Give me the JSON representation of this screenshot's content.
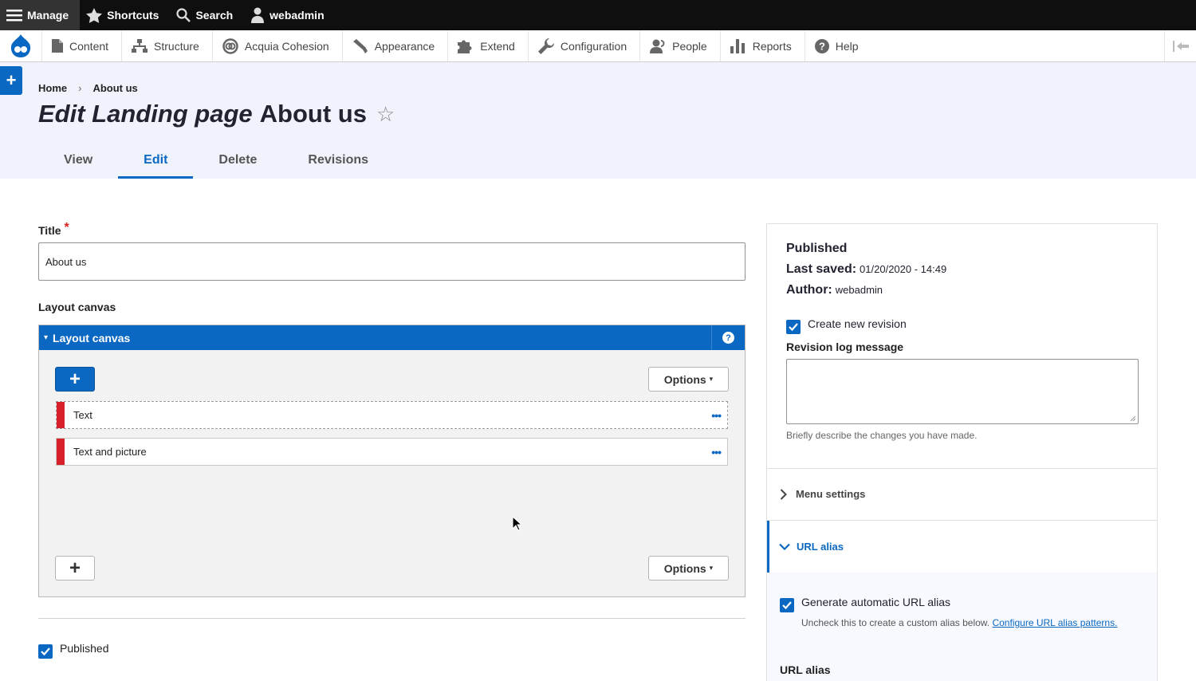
{
  "toolbar": {
    "manage": "Manage",
    "shortcuts": "Shortcuts",
    "search": "Search",
    "user": "webadmin"
  },
  "admin_menu": [
    {
      "label": "Content",
      "icon": "file-icon"
    },
    {
      "label": "Structure",
      "icon": "sitemap-icon"
    },
    {
      "label": "Acquia Cohesion",
      "icon": "cohesion-icon"
    },
    {
      "label": "Appearance",
      "icon": "brush-icon"
    },
    {
      "label": "Extend",
      "icon": "puzzle-icon"
    },
    {
      "label": "Configuration",
      "icon": "wrench-icon"
    },
    {
      "label": "People",
      "icon": "person-icon"
    },
    {
      "label": "Reports",
      "icon": "bar-chart-icon"
    },
    {
      "label": "Help",
      "icon": "question-icon"
    }
  ],
  "breadcrumb": {
    "home": "Home",
    "separator": "›",
    "current": "About us"
  },
  "page_title": {
    "prefix": "Edit Landing page",
    "name": "About us",
    "star": "☆"
  },
  "tabs": [
    "View",
    "Edit",
    "Delete",
    "Revisions"
  ],
  "form": {
    "title_label": "Title",
    "required_mark": "*",
    "title_value": "About us",
    "layout_canvas_label": "Layout canvas",
    "canvas_header": "Layout canvas",
    "canvas_caret": "▾",
    "help_mark": "?",
    "add_symbol": "+",
    "options_label": "Options",
    "options_caret": "▾",
    "elements": [
      {
        "label": "Text",
        "menu": "•••"
      },
      {
        "label": "Text and picture",
        "menu": "•••"
      }
    ],
    "published_label": "Published"
  },
  "sidebar": {
    "status": "Published",
    "last_saved_label": "Last saved:",
    "last_saved_value": "01/20/2020 - 14:49",
    "author_label": "Author:",
    "author_value": "webadmin",
    "create_revision_label": "Create new revision",
    "revision_log_label": "Revision log message",
    "revision_log_hint": "Briefly describe the changes you have made.",
    "menu_settings": "Menu settings",
    "url_alias_section": "URL alias",
    "generate_alias_label": "Generate automatic URL alias",
    "generate_alias_hint": "Uncheck this to create a custom alias below.",
    "configure_link": "Configure URL alias patterns.",
    "url_alias_field_label": "URL alias"
  },
  "colors": {
    "accent": "#0a68c2",
    "element_bar": "#d8202b",
    "toolbar": "#0f0f0f"
  }
}
